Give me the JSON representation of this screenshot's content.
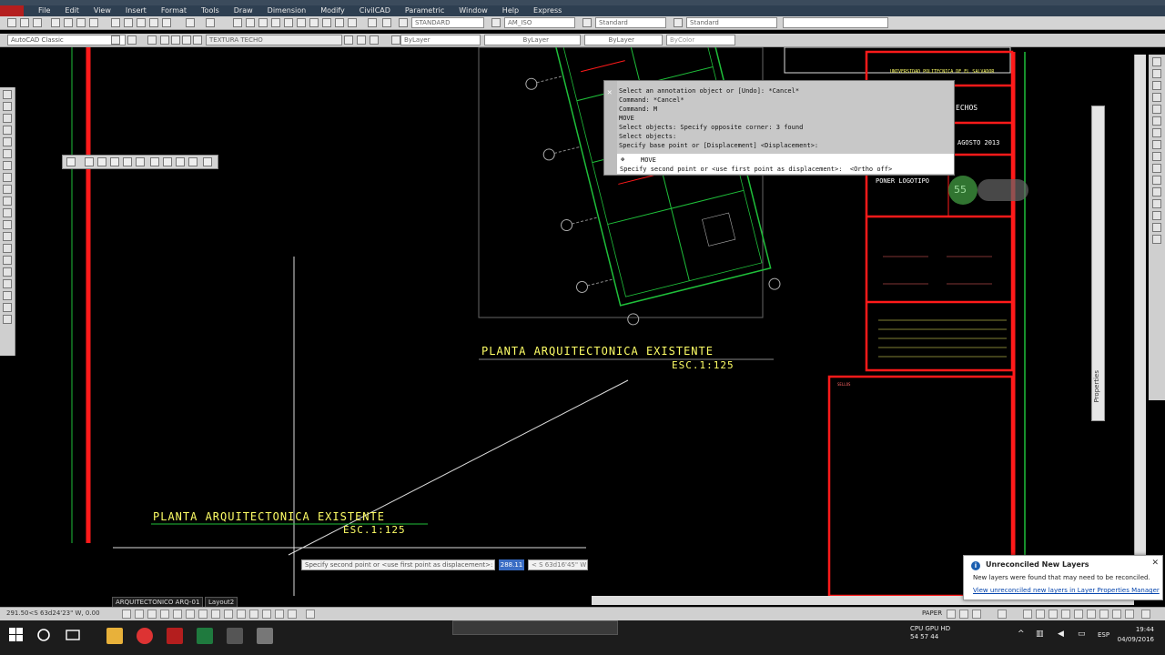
{
  "menu": {
    "items": [
      "File",
      "Edit",
      "View",
      "Insert",
      "Format",
      "Tools",
      "Draw",
      "Dimension",
      "Modify",
      "CivilCAD",
      "Parametric",
      "Window",
      "Help",
      "Express"
    ]
  },
  "toolbar1": {
    "text_style": "STANDARD",
    "dim_style": "AM_ISO",
    "table_style": "Standard",
    "multileader_style": "Standard"
  },
  "toolbar2": {
    "workspace": "AutoCAD Classic",
    "layer": "TEXTURA TECHO",
    "color": "ByLayer",
    "linetype": "ByLayer",
    "lineweight": "ByLayer",
    "plotstyle": "ByColor"
  },
  "command_window": {
    "lines": [
      "Select an annotation object or [Undo]: *Cancel*",
      "Command: *Cancel*",
      "Command: M",
      "MOVE",
      "Select objects: Specify opposite corner: 3 found",
      "Select objects:",
      "Specify base point or [Displacement] <Displacement>:"
    ],
    "active_command": "MOVE",
    "prompt": "Specify second point or <use first point as displacement>:  <Ortho off>"
  },
  "dynamic_input": {
    "prompt": "Specify second point or <use first point as displacement>:",
    "value": "288.11",
    "angle": "< S 63d16'45\" W"
  },
  "drawing": {
    "plan_title_top": "PLANTA ARQUITECTONICA EXISTENTE",
    "plan_scale_top": "ESC.1:125",
    "plan_title_bottom": "PLANTA ARQUITECTONICA EXISTENTE",
    "plan_scale_bottom": "ESC.1:125",
    "title_block": {
      "university": "UNIVERSIDAD POLITECNICA DE EL SALVADOR",
      "sheet_title": "ECHOS",
      "date": "AGOSTO 2013",
      "logo_placeholder": "PONER LOGOTIPO",
      "stamp_label": "SELLOS"
    },
    "zoom_badge": "55"
  },
  "layout_tabs": {
    "tabs": [
      "ARQUITECTONICO ARQ-01",
      "Layout2"
    ]
  },
  "status_bar": {
    "coordinates": "291.50<S 63d24'23\" W, 0.00",
    "space": "PAPER"
  },
  "properties_panel": {
    "label": "Properties"
  },
  "notification": {
    "title": "Unreconciled New Layers",
    "body": "New layers were found that may need to be reconciled.",
    "link": "View unreconciled new layers in Layer Properties Manager"
  },
  "taskbar": {
    "cpu_label": "CPU GPU HD",
    "cpu_values": "54   57   44",
    "language": "ESP",
    "time": "19:44",
    "date": "04/09/2016"
  },
  "colors": {
    "cad_red": "#ff1a1a",
    "cad_green": "#1fbf3a",
    "cad_yellow": "#ffff66",
    "menu_bg": "#2e3f51"
  }
}
